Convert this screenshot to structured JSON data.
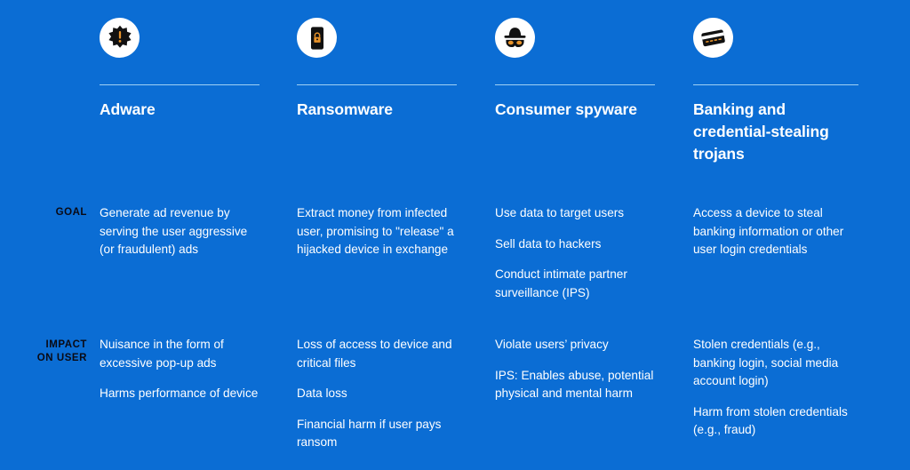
{
  "theme": {
    "background": "#0B6DD4",
    "text": "#FFFFFF",
    "label_text": "#0A0A14",
    "divider": "#9FD0F5",
    "badge_background": "#FFFFFF",
    "icon_dark": "#111111",
    "icon_accent": "#E8932A"
  },
  "row_labels": {
    "goal": "GOAL",
    "impact_line1": "IMPACT",
    "impact_line2": "ON USER"
  },
  "columns": [
    {
      "icon": "adware-burst-icon",
      "title": "Adware",
      "goal": [
        "Generate ad revenue by serving the user aggressive (or fraudulent) ads"
      ],
      "impact": [
        "Nuisance in the form of excessive pop-up ads",
        "Harms performance of device"
      ]
    },
    {
      "icon": "ransomware-locked-phone-icon",
      "title": "Ransomware",
      "goal": [
        "Extract money from infected user, promising to \"release\" a hijacked device in exchange"
      ],
      "impact": [
        "Loss of access to device and critical files",
        "Data loss",
        "Financial harm if user pays ransom"
      ]
    },
    {
      "icon": "spyware-incognito-icon",
      "title": "Consumer spyware",
      "goal": [
        "Use data to target users",
        "Sell data to hackers",
        "Conduct intimate partner surveillance (IPS)"
      ],
      "impact": [
        "Violate users’ privacy",
        "IPS: Enables abuse, potential physical and mental harm"
      ]
    },
    {
      "icon": "banking-credit-card-icon",
      "title": "Banking and credential-stealing trojans",
      "goal": [
        "Access a device to steal banking information or other user login credentials"
      ],
      "impact": [
        "Stolen credentials (e.g., banking login, social media account login)",
        "Harm from stolen credentials (e.g., fraud)"
      ]
    }
  ]
}
